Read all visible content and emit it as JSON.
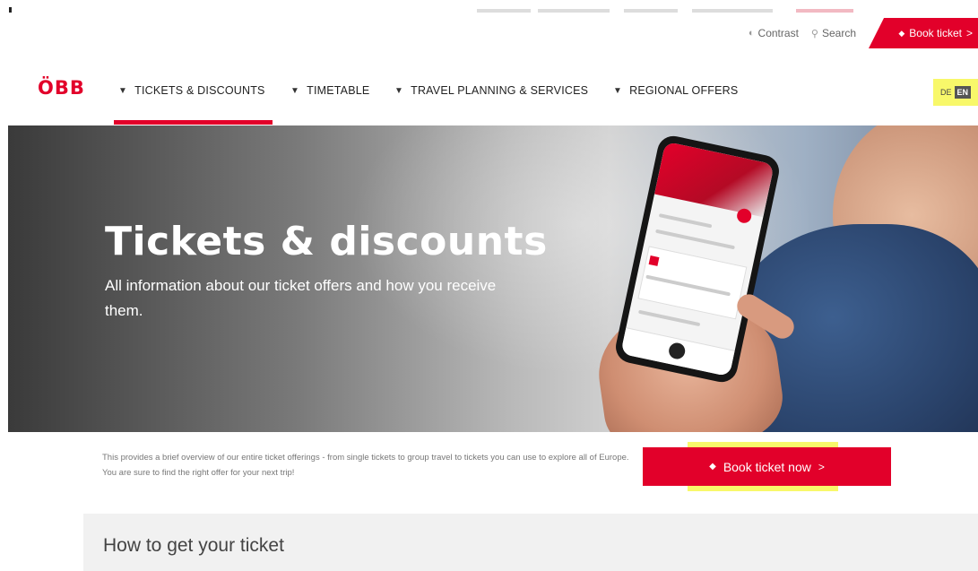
{
  "utility": {
    "contrast_label": "Contrast",
    "search_label": "Search",
    "book_ticket_label": "Book ticket",
    "book_arrow": ">"
  },
  "brand": {
    "logo": "ÖBB",
    "accent_color": "#e2002a",
    "highlight_color": "#f8f86a"
  },
  "nav": {
    "items": [
      {
        "label": "TICKETS & DISCOUNTS",
        "active": true
      },
      {
        "label": "TIMETABLE"
      },
      {
        "label": "TRAVEL PLANNING & SERVICES"
      },
      {
        "label": "REGIONAL OFFERS"
      }
    ]
  },
  "language": {
    "de": "DE",
    "en": "EN",
    "selected": "EN"
  },
  "hero": {
    "title": "Tickets & discounts",
    "subtitle": "All information about our ticket offers and how you receive them."
  },
  "intro": {
    "text": "This provides a brief overview of our entire ticket offerings - from single tickets to group travel to tickets you can use to explore all of Europe. You are sure to find the right offer for your next trip!"
  },
  "cta": {
    "label": "Book ticket now",
    "arrow": ">"
  },
  "section": {
    "title": "How to get your ticket"
  },
  "icons": {
    "contrast": "contrast-icon",
    "search": "search-icon",
    "ticket": "ticket-icon",
    "chevron": "chevron-down-icon"
  }
}
